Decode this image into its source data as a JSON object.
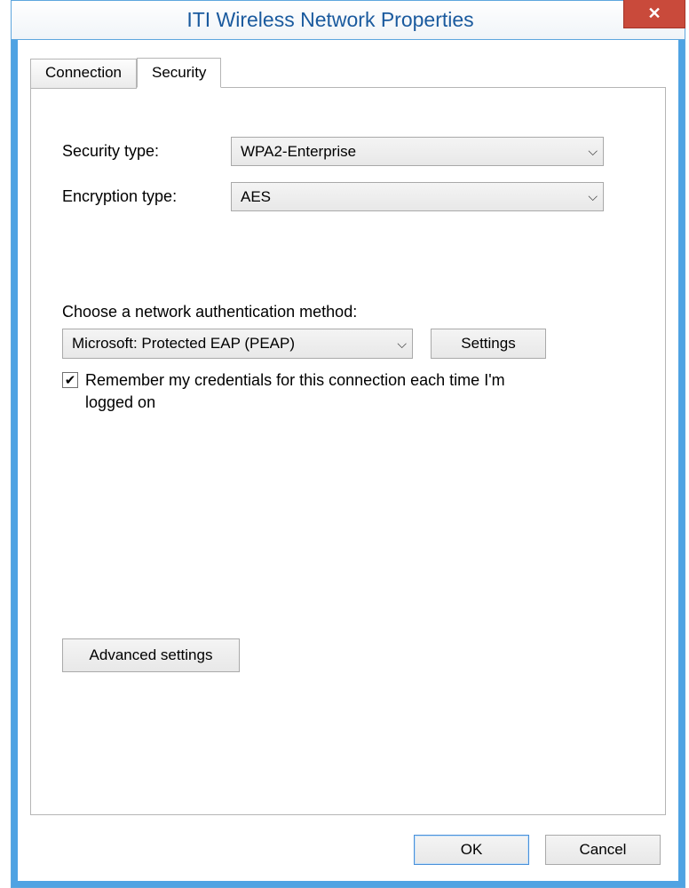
{
  "window": {
    "title": "ITI Wireless Network Properties"
  },
  "tabs": [
    {
      "label": "Connection",
      "active": false
    },
    {
      "label": "Security",
      "active": true
    }
  ],
  "security": {
    "security_type_label": "Security type:",
    "security_type_value": "WPA2-Enterprise",
    "encryption_type_label": "Encryption type:",
    "encryption_type_value": "AES",
    "auth_method_label": "Choose a network authentication method:",
    "auth_method_value": "Microsoft: Protected EAP (PEAP)",
    "settings_button": "Settings",
    "remember_checkbox_label": "Remember my credentials for this connection each time I'm logged on",
    "remember_checkbox_checked": true,
    "advanced_button": "Advanced settings"
  },
  "buttons": {
    "ok": "OK",
    "cancel": "Cancel"
  },
  "icons": {
    "close": "✕",
    "chevron": "⌵",
    "check": "✔"
  }
}
